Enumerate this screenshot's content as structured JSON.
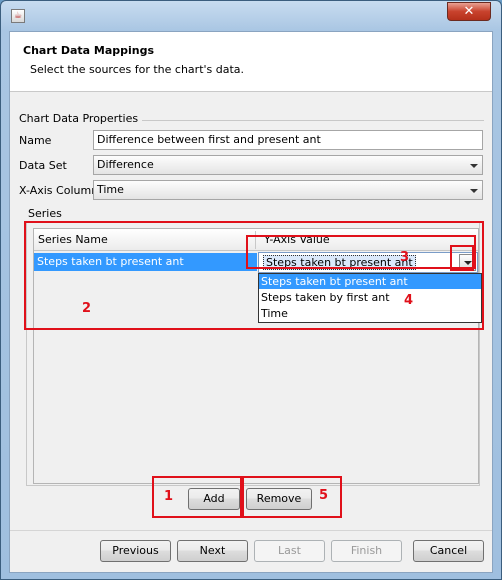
{
  "window": {
    "close_label": "✕"
  },
  "header": {
    "title": "Chart Data Mappings",
    "subtitle": "Select the sources for the chart's data."
  },
  "properties": {
    "group_title": "Chart Data Properties",
    "name_label": "Name",
    "name_value": "Difference between first and present ant",
    "dataset_label": "Data Set",
    "dataset_value": "Difference",
    "xaxis_label": "X-Axis Column",
    "xaxis_value": "Time"
  },
  "series": {
    "group_title": "Series",
    "columns": [
      "Series Name",
      "Y-Axis Value"
    ],
    "row": {
      "name": "Steps taken bt present ant",
      "yaxis": "Steps taken bt present ant"
    },
    "dropdown_options": [
      "Steps taken bt present ant",
      "Steps taken by first ant",
      "Time"
    ],
    "dropdown_selected_index": 0
  },
  "buttons": {
    "add": "Add",
    "remove": "Remove",
    "previous": "Previous",
    "next": "Next",
    "last": "Last",
    "finish": "Finish",
    "cancel": "Cancel"
  },
  "annotations": [
    "1",
    "2",
    "3",
    "4",
    "5"
  ],
  "colors": {
    "annotation": "#e0101a",
    "selection": "#3399ff"
  }
}
